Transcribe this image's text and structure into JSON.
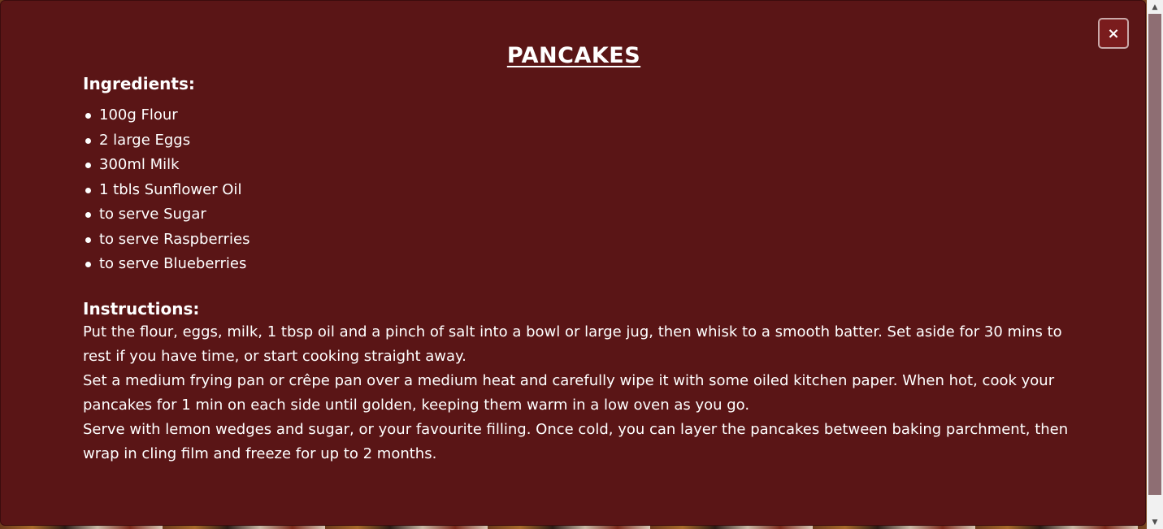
{
  "modal": {
    "close_label": "×",
    "title": "PANCAKES",
    "ingredients_heading": "Ingredients:",
    "ingredients": [
      "100g Flour",
      "2 large Eggs",
      "300ml Milk",
      "1 tbls Sunflower Oil",
      "to serve Sugar",
      "to serve Raspberries",
      "to serve Blueberries"
    ],
    "instructions_heading": "Instructions:",
    "instructions": [
      "Put the flour, eggs, milk, 1 tbsp oil and a pinch of salt into a bowl or large jug, then whisk to a smooth batter. Set aside for 30 mins to rest if you have time, or start cooking straight away.",
      "Set a medium frying pan or crêpe pan over a medium heat and carefully wipe it with some oiled kitchen paper. When hot, cook your pancakes for 1 min on each side until golden, keeping them warm in a low oven as you go.",
      "Serve with lemon wedges and sugar, or your favourite filling. Once cold, you can layer the pancakes between baking parchment, then wrap in cling film and freeze for up to 2 months."
    ]
  },
  "scrollbar": {
    "up_arrow": "▲",
    "down_arrow": "▼"
  },
  "colors": {
    "modal_background": "#5a1516",
    "text": "#ffffff",
    "scroll_thumb": "#8e6e73"
  },
  "icons": {
    "close": "close-icon",
    "bullet": "bullet-icon"
  }
}
